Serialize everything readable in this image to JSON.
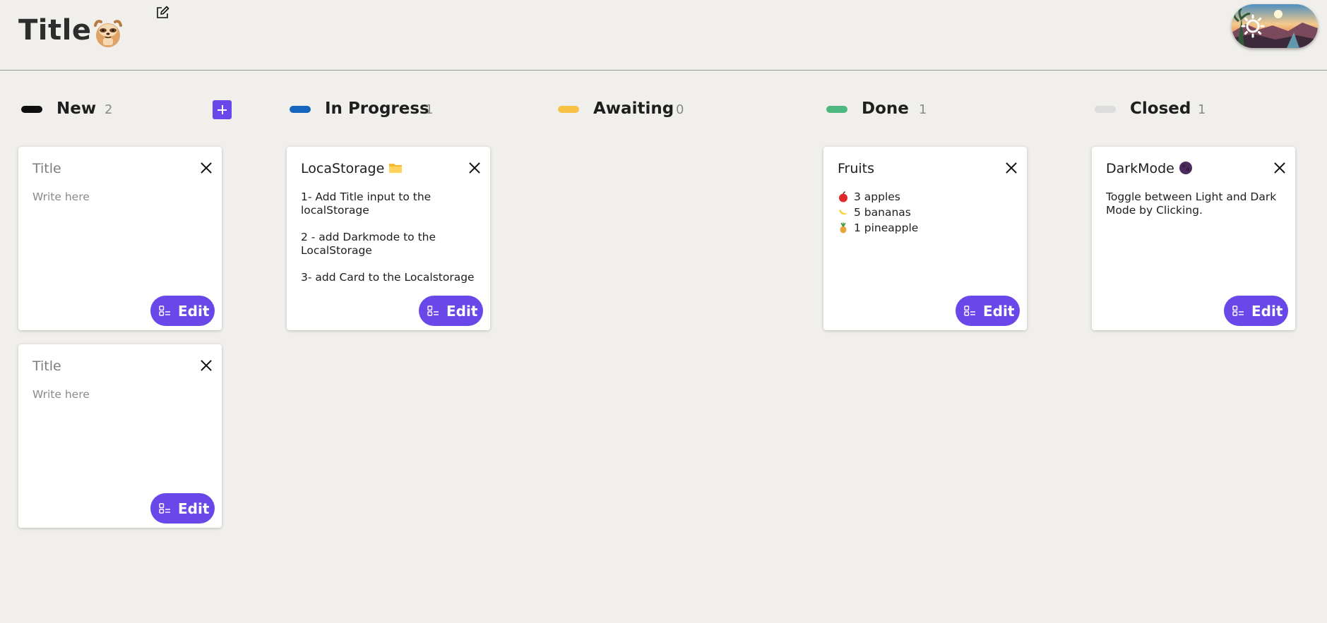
{
  "header": {
    "title": "Title"
  },
  "colors": {
    "accent": "#6a47e8",
    "background": "#f0efeb"
  },
  "columns": [
    {
      "name": "New",
      "count": "2",
      "color": "#0f0f0f",
      "cards": [
        {
          "title": "Title",
          "body": "Write here",
          "edit_label": "Edit"
        },
        {
          "title": "Title",
          "body": "Write here",
          "edit_label": "Edit"
        }
      ]
    },
    {
      "name": "In Progress",
      "count": "1",
      "color": "#1565c0",
      "cards": [
        {
          "title": "LocaStorage",
          "emoji": "folder-emoji",
          "lines": [
            "1- Add Title input to the localStorage",
            "2 - add Darkmode to the LocalStorage",
            "3- add Card  to the Localstorage"
          ],
          "edit_label": "Edit"
        }
      ]
    },
    {
      "name": "Awaiting",
      "count": "0",
      "color": "#f7c244",
      "cards": []
    },
    {
      "name": "Done",
      "count": "1",
      "color": "#4cb87f",
      "cards": [
        {
          "title": "Fruits",
          "items": [
            {
              "icon": "apple-emoji",
              "text": "3 apples"
            },
            {
              "icon": "banana-emoji",
              "text": "5 bananas"
            },
            {
              "icon": "pineapple-emoji",
              "text": "1 pineapple"
            }
          ],
          "edit_label": "Edit"
        }
      ]
    },
    {
      "name": "Closed",
      "count": "1",
      "color": "#dcdcdc",
      "cards": [
        {
          "title": "DarkMode",
          "emoji": "new-moon-emoji",
          "body": "Toggle between Light and Dark Mode  by Clicking.",
          "edit_label": "Edit"
        }
      ]
    }
  ]
}
